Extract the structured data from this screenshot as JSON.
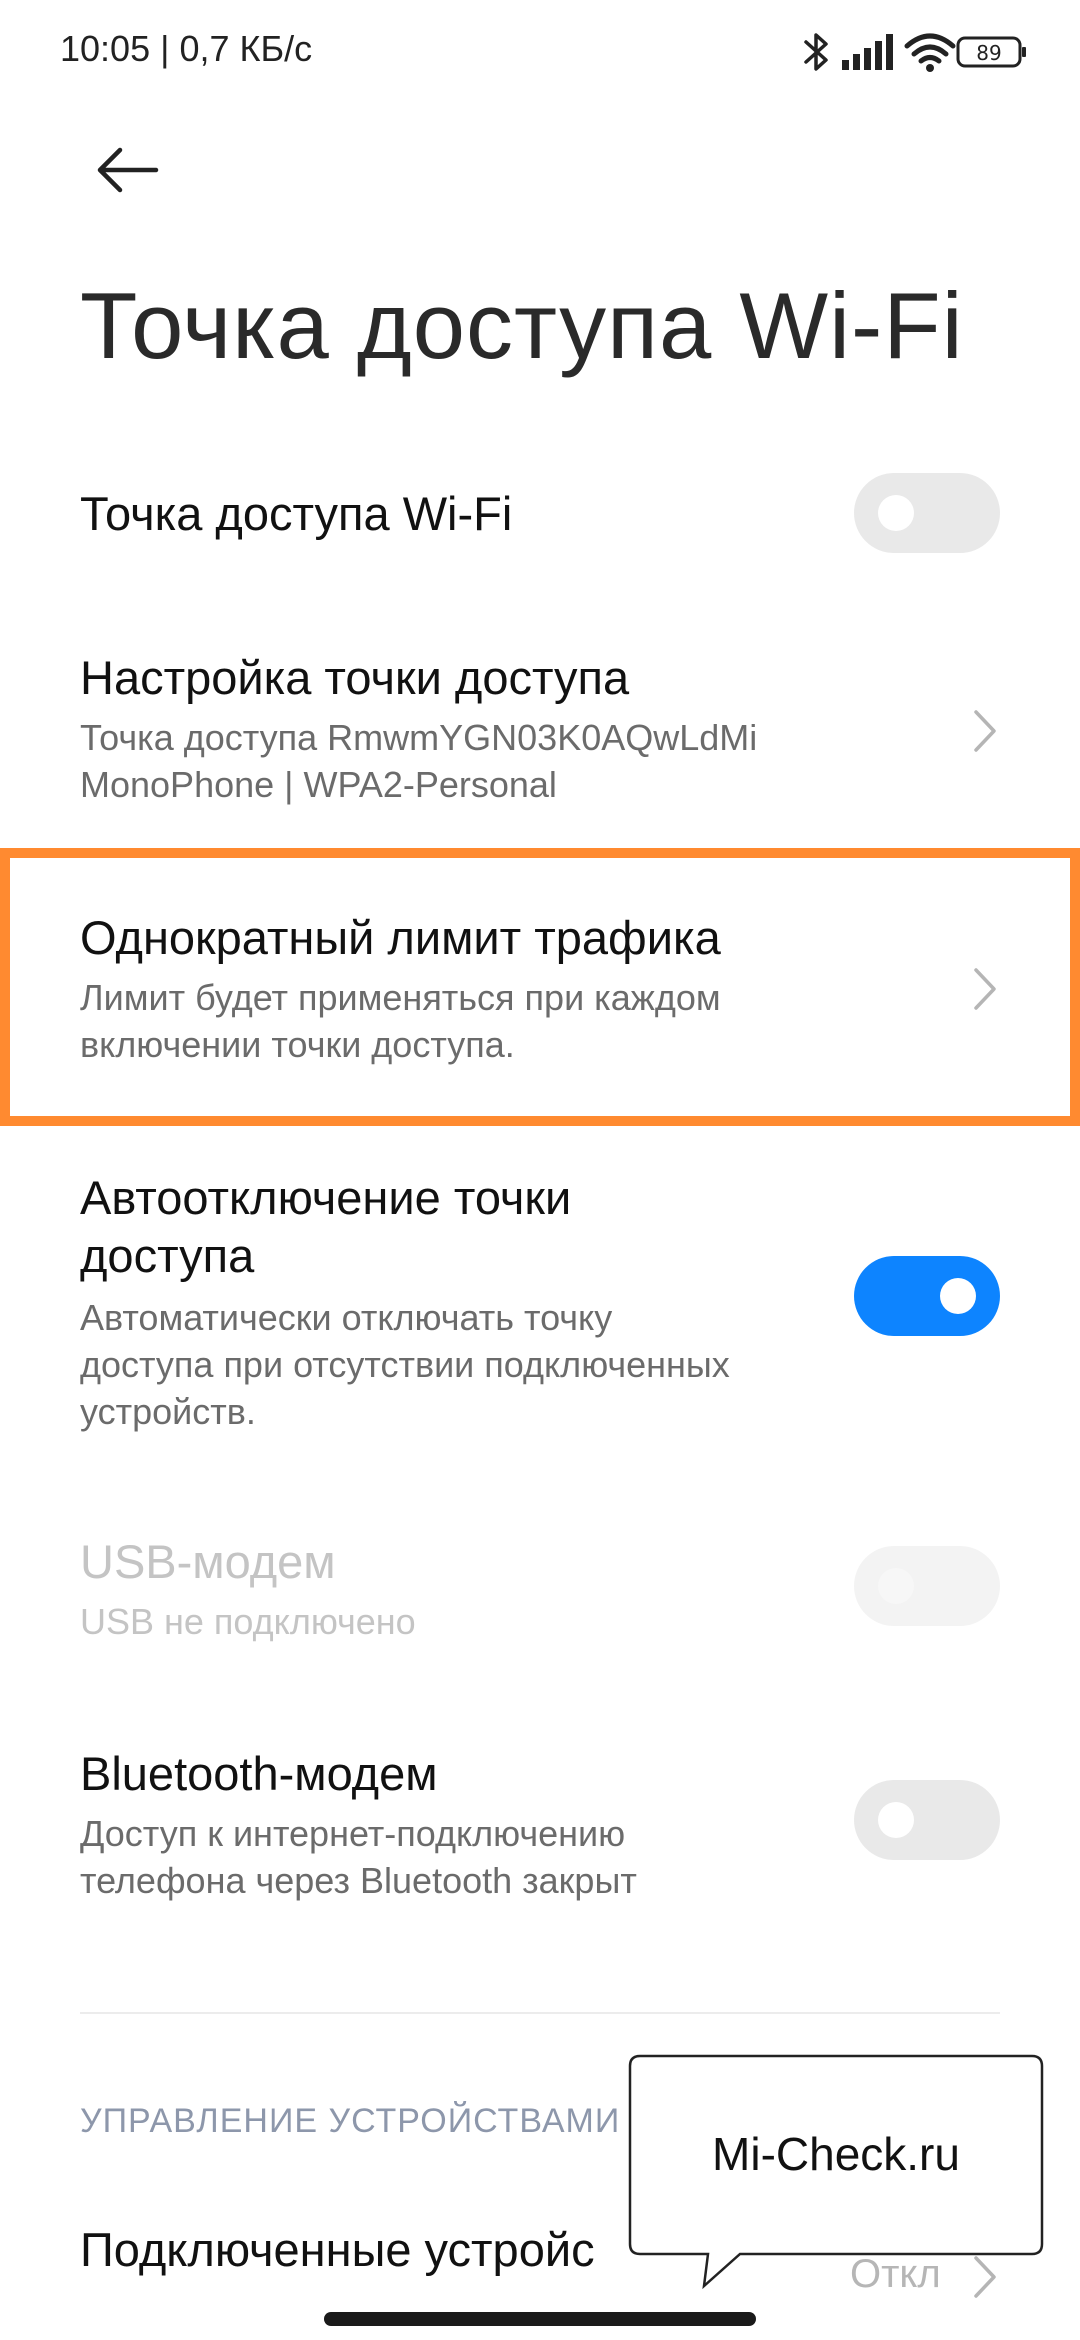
{
  "status_bar": {
    "time": "10:05 | 0,7 КБ/с",
    "battery": "89",
    "icons": [
      "bluetooth-icon",
      "signal-icon",
      "wifi-icon",
      "battery-icon"
    ]
  },
  "header": {
    "back_icon": "arrow-left-icon",
    "title": "Точка доступа Wi-Fi"
  },
  "settings": {
    "hotspot": {
      "title": "Точка доступа Wi-Fi",
      "toggle": "off"
    },
    "hotspot_config": {
      "title": "Настройка точки доступа",
      "subtitle_line1": "Точка доступа RmwmYGN03K0AQwLdMi",
      "subtitle_line2": "MonoPhone | WPA2-Personal"
    },
    "traffic_limit": {
      "title": "Однократный лимит трафика",
      "subtitle_line1": "Лимит будет применяться при каждом",
      "subtitle_line2": "включении точки доступа."
    },
    "auto_off": {
      "title_line1": "Автоотключение точки",
      "title_line2": "доступа",
      "subtitle_line1": "Автоматически отключать точку",
      "subtitle_line2": "доступа при отсутствии подключенных",
      "subtitle_line3": "устройств.",
      "toggle": "on"
    },
    "usb_modem": {
      "title": "USB-модем",
      "subtitle": "USB не подключено",
      "toggle": "disabled"
    },
    "bluetooth_modem": {
      "title": "Bluetooth-модем",
      "subtitle_line1": "Доступ к интернет-подключению",
      "subtitle_line2": "телефона через Bluetooth закрыт",
      "toggle": "off"
    }
  },
  "device_management": {
    "section_header": "УПРАВЛЕНИЕ УСТРОЙСТВАМИ",
    "connected_devices_title": "Подключенные устройс",
    "connected_devices_value": "Откл"
  },
  "watermark": {
    "text": "Mi-Check.ru"
  },
  "colors": {
    "accent_blue": "#0d84ff",
    "highlight_orange": "#ff8a30",
    "section_header": "#8d97ab"
  }
}
